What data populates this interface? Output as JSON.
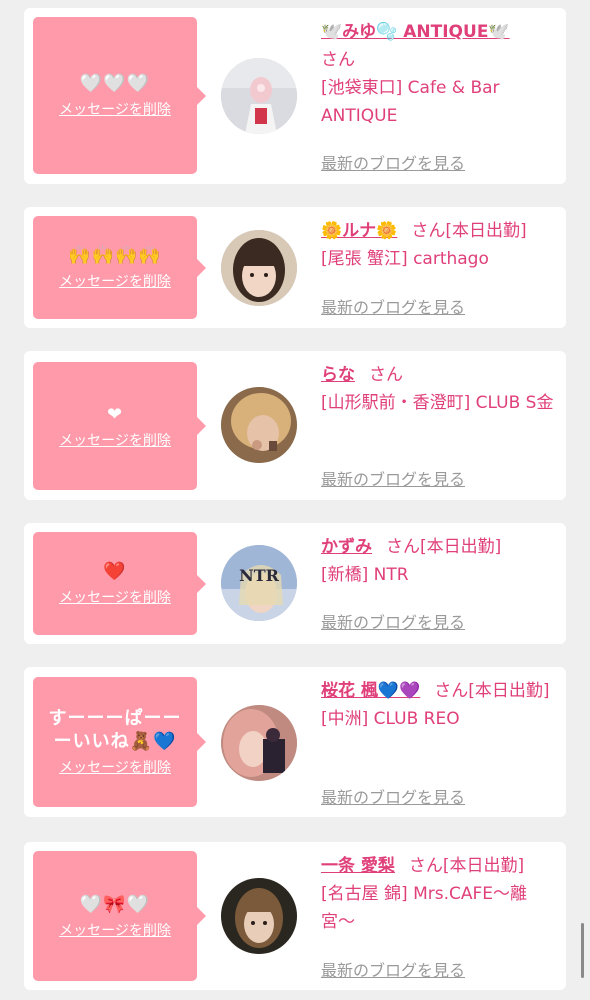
{
  "delete_label": "メッセージを削除",
  "blog_label": "最新のブログを見る",
  "accent_color": "#e0407a",
  "bubble_color": "#ff9aaa",
  "cards": [
    {
      "message": "🤍🤍🤍",
      "name": "🕊️みゆ🫧 ANTIQUE🕊️",
      "honorific": "さん",
      "status": "",
      "shop": "[池袋東口] Cafe & Bar ANTIQUE"
    },
    {
      "message": "🙌🙌🙌🙌",
      "name": "🌼ルナ🌼",
      "honorific": "さん",
      "status": "[本日出勤]",
      "shop": "[尾張 蟹江] carthago"
    },
    {
      "message": "❤",
      "name": "らな",
      "honorific": "さん",
      "status": "",
      "shop": "[山形駅前・香澄町] CLUB S金"
    },
    {
      "message": "❤️",
      "name": "かずみ",
      "honorific": "さん",
      "status": "[本日出勤]",
      "shop": "[新橋] NTR"
    },
    {
      "message": "すーーーぱーーーいいね🧸💙",
      "name": "桜花 楓💙💜",
      "honorific": "さん",
      "status": "[本日出勤]",
      "shop": "[中洲] CLUB REO"
    },
    {
      "message": "🤍🎀🤍",
      "name": "一条 愛梨",
      "honorific": "さん",
      "status": "[本日出勤]",
      "shop": "[名古屋 錦] Mrs.CAFE〜離宮〜"
    }
  ]
}
